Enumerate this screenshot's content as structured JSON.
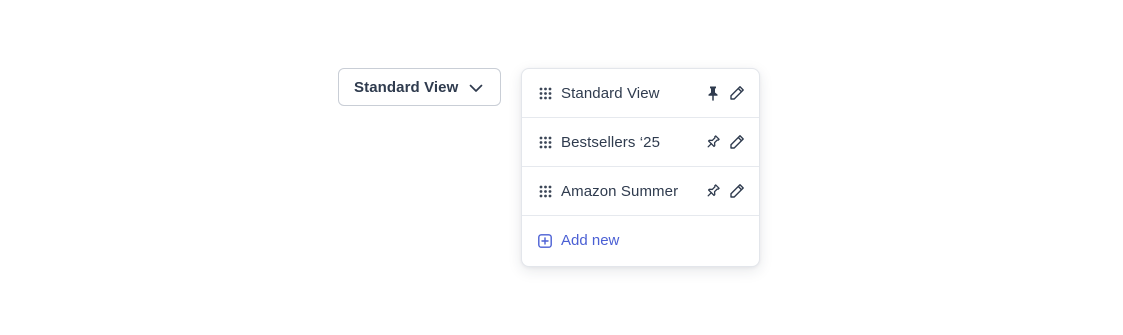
{
  "trigger": {
    "label": "Standard View",
    "icon": "chevron-down-icon"
  },
  "menu": {
    "items": [
      {
        "label": "Standard View",
        "pinned": true
      },
      {
        "label": "Bestsellers ‘25",
        "pinned": false
      },
      {
        "label": "Amazon Summer",
        "pinned": false
      }
    ],
    "add_label": "Add new"
  },
  "colors": {
    "text": "#2f3b4e",
    "accent": "#4a5fd4",
    "border": "#c9ced6",
    "divider": "#e6e9ee"
  }
}
